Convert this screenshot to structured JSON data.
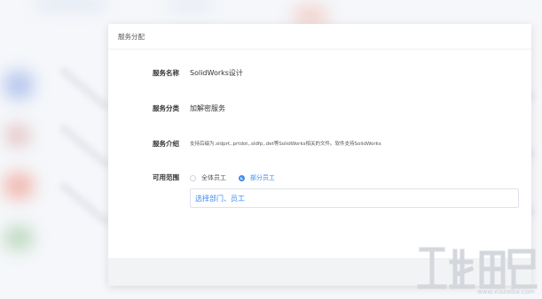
{
  "dialog": {
    "title": "服务分配",
    "fields": {
      "name": {
        "label": "服务名称",
        "value": "SolidWorks设计"
      },
      "category": {
        "label": "服务分类",
        "value": "加解密服务"
      },
      "intro": {
        "label": "服务介绍",
        "value": "支持后缀为.sldprt,.prtdot,.sldfp,.det等SolidWorks相关的文件。软件支持SolidWorks"
      },
      "scope": {
        "label": "可用范围",
        "options": [
          {
            "label": "全体员工",
            "checked": false
          },
          {
            "label": "部分员工",
            "checked": true
          }
        ],
        "select_text": "选择部门、员工"
      }
    }
  },
  "watermark": {
    "text": "www.xiazaiba.com"
  },
  "colors": {
    "accent": "#3b8cf2",
    "footer_bg": "#f2f3f5"
  }
}
